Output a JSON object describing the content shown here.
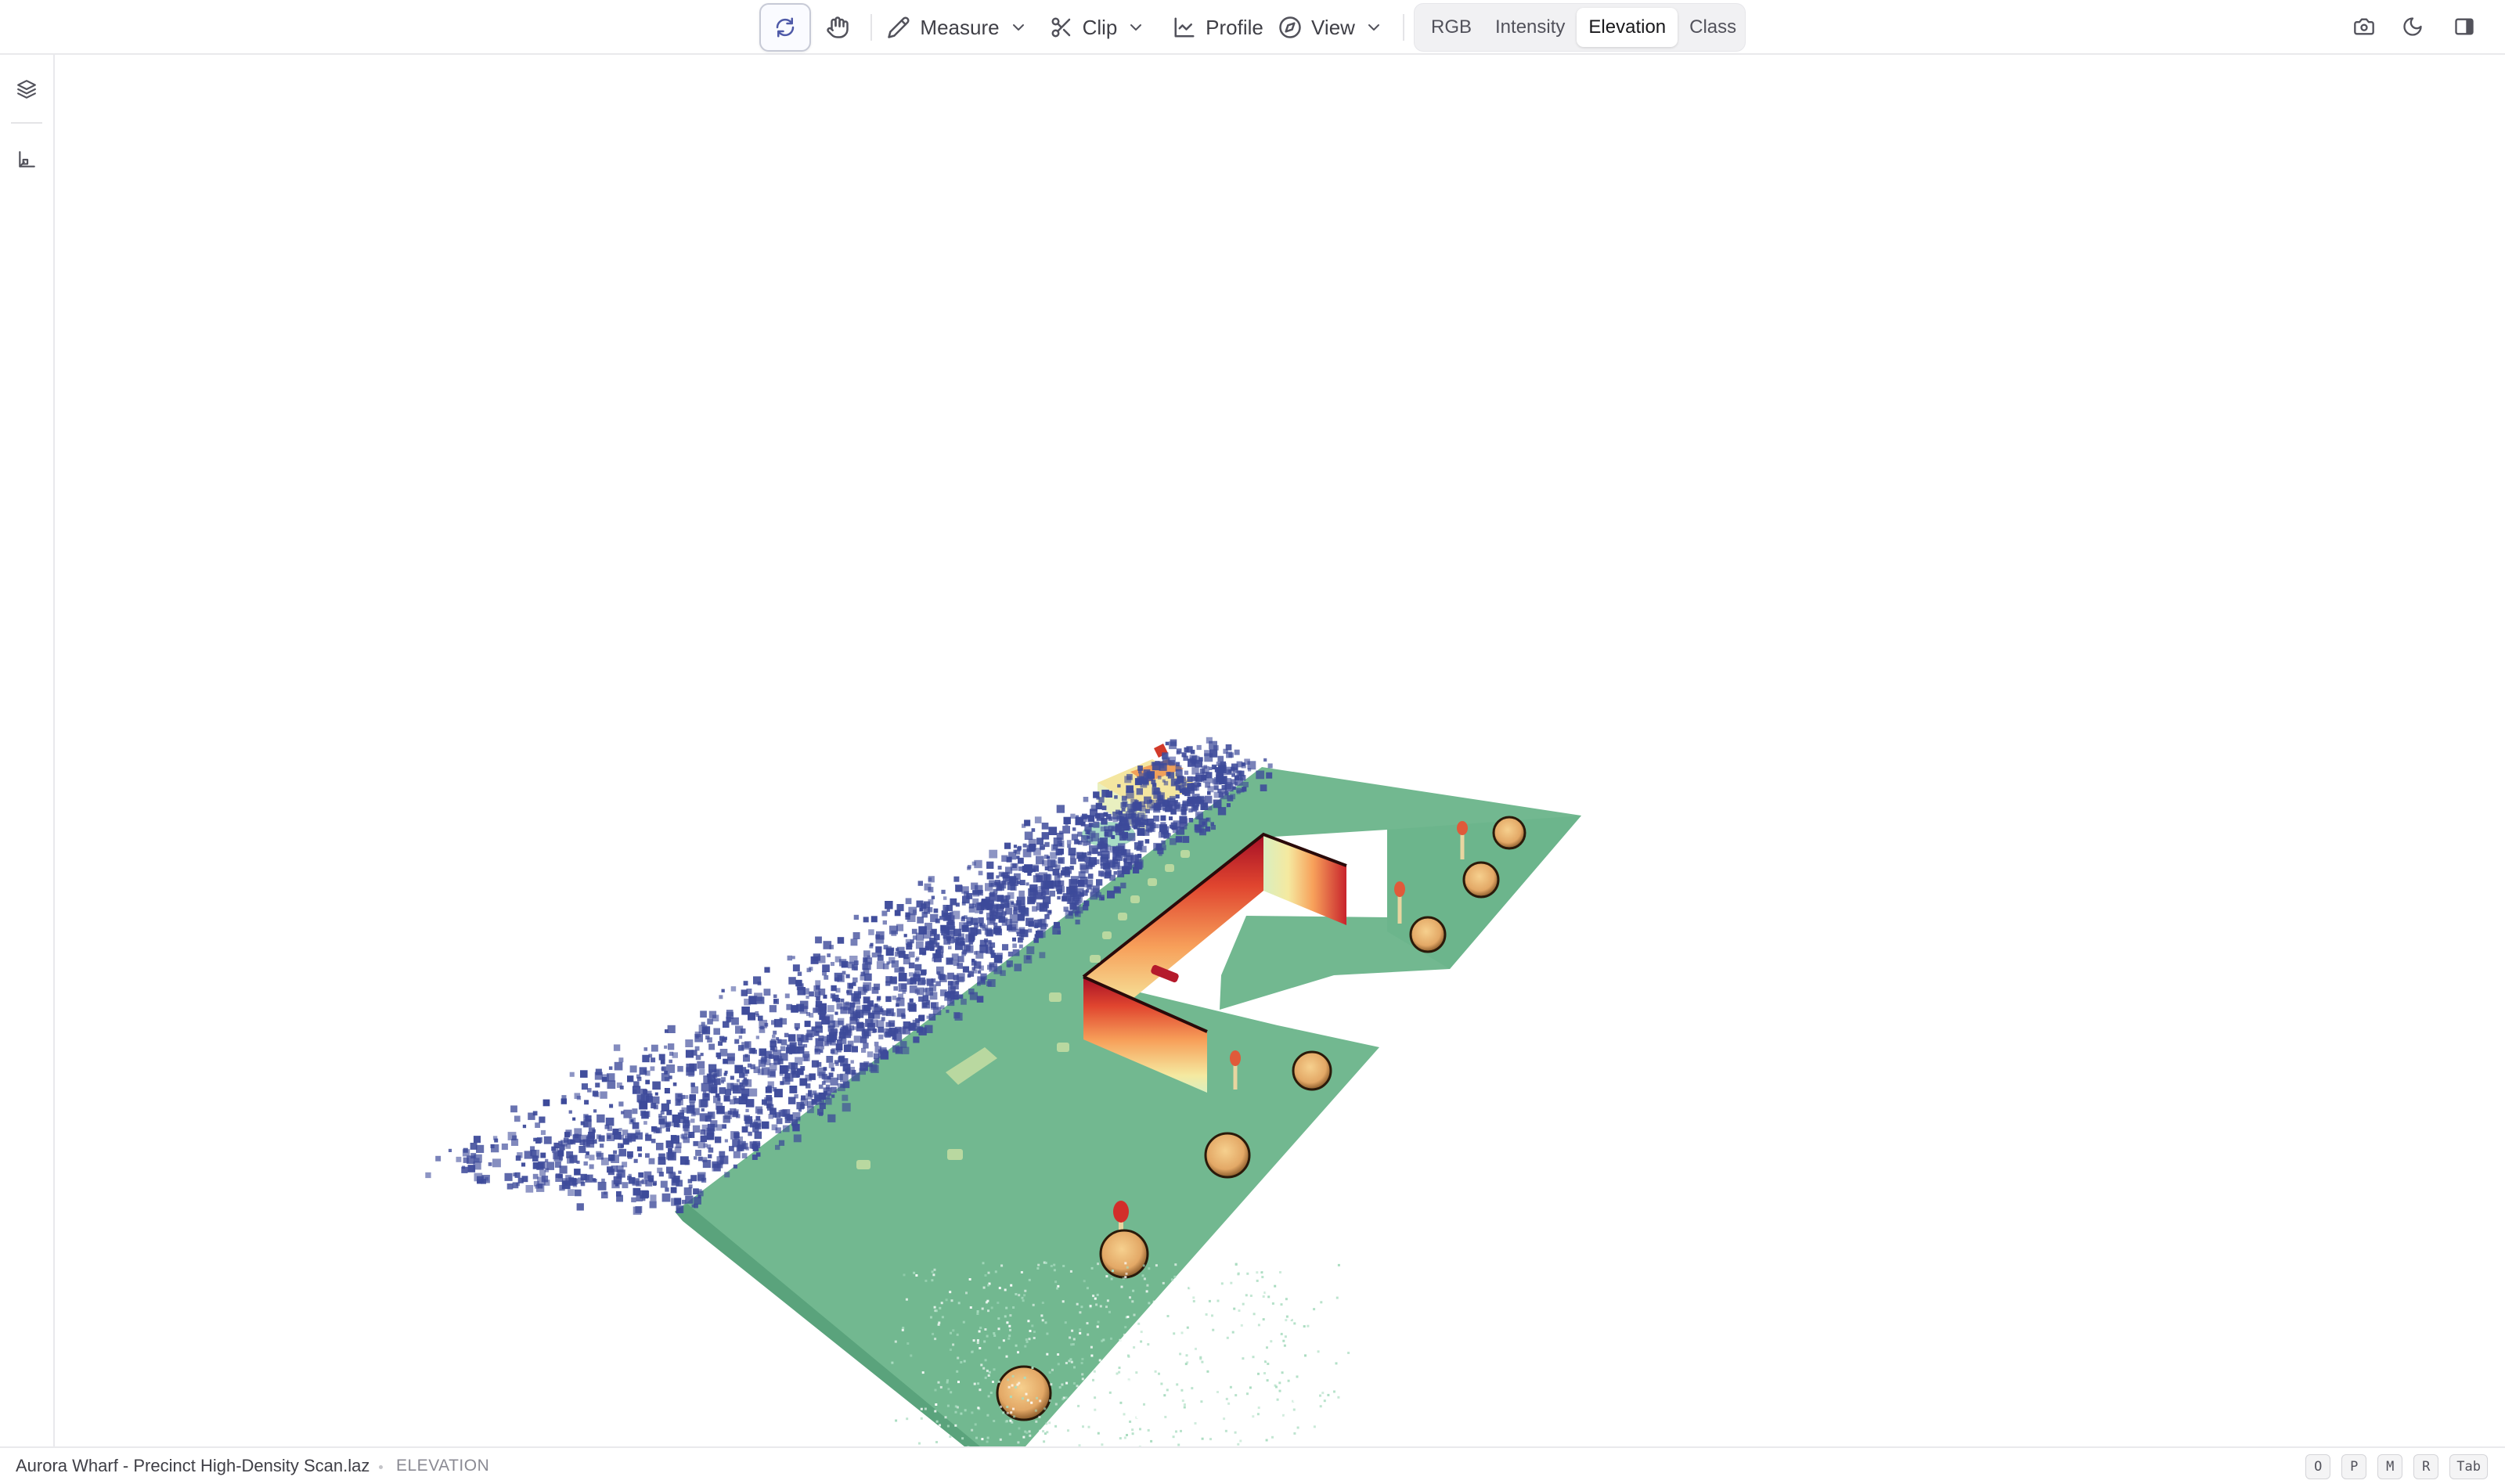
{
  "toolbar": {
    "orbit": {
      "icon": "orbit-rotate-icon",
      "active": true
    },
    "pan": {
      "icon": "hand-pan-icon"
    },
    "measure": {
      "label": "Measure",
      "icon": "ruler-pencil-icon"
    },
    "clip": {
      "label": "Clip",
      "icon": "scissors-icon"
    },
    "profile": {
      "label": "Profile",
      "icon": "line-chart-icon"
    },
    "view": {
      "label": "View",
      "icon": "compass-icon"
    },
    "color_modes": [
      {
        "label": "RGB",
        "active": false
      },
      {
        "label": "Intensity",
        "active": false
      },
      {
        "label": "Elevation",
        "active": true
      },
      {
        "label": "Class",
        "active": false
      }
    ],
    "right_icons": [
      "camera-icon",
      "moon-icon",
      "panel-toggle-icon"
    ]
  },
  "sidebar": {
    "items": [
      {
        "icon": "layers-icon"
      },
      {
        "icon": "axes-icon"
      }
    ]
  },
  "status": {
    "file_name": "Aurora Wharf - Precinct High-Density Scan.laz",
    "mode": "ELEVATION",
    "shortcut_keys": [
      "O",
      "P",
      "M",
      "R",
      "Tab"
    ]
  },
  "colors": {
    "ground": "#6fb78f",
    "low_points": "#3d4a9a",
    "building_top": "#a50f26",
    "building_mid": "#f0a05a",
    "building_low": "#f5e9a0",
    "tree": "#eab774"
  }
}
